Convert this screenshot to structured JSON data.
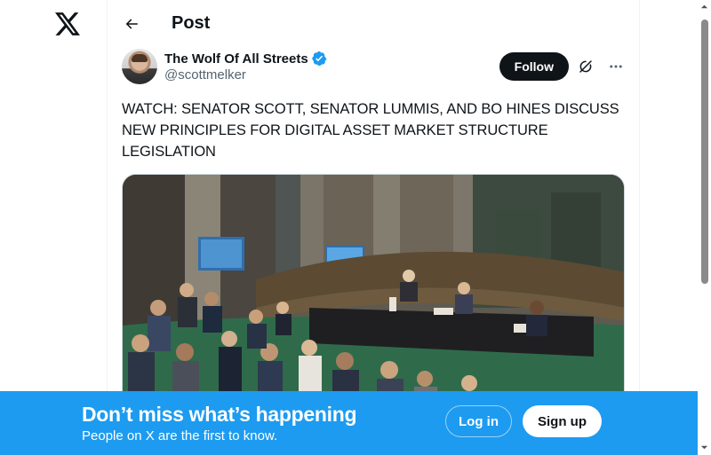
{
  "nav": {
    "logo_icon": "x-logo-icon"
  },
  "header": {
    "back_icon": "arrow-left-icon",
    "title": "Post"
  },
  "tweet": {
    "author": {
      "name": "The Wolf Of All Streets",
      "handle": "@scottmelker",
      "verified_icon": "verified-badge-icon",
      "verified_color": "#1d9bf0"
    },
    "follow_label": "Follow",
    "grok_icon": "grok-icon",
    "more_icon": "more-horizontal-icon",
    "text": "WATCH: SENATOR SCOTT, SENATOR LUMMIS, AND BO HINES DISCUSS NEW PRINCIPLES FOR DIGITAL ASSET MARKET STRUCTURE LEGISLATION",
    "media": {
      "type": "photo"
    }
  },
  "banner": {
    "title": "Don’t miss what’s happening",
    "subtitle": "People on X are the first to know.",
    "login_label": "Log in",
    "signup_label": "Sign up",
    "background": "#1d9bf0"
  },
  "colors": {
    "text": "#0f1419",
    "secondary": "#536471",
    "accent": "#1d9bf0"
  }
}
